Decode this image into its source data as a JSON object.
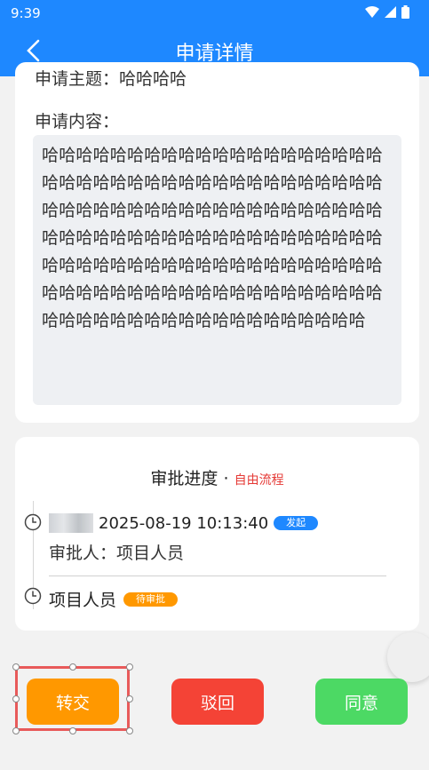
{
  "status_bar": {
    "time": "9:39",
    "icons": [
      "wifi-icon",
      "signal-icon",
      "battery-icon"
    ]
  },
  "app_bar": {
    "title": "申请详情",
    "back_icon": "chevron-left-icon"
  },
  "application": {
    "subject_text": "申请主题：哈哈哈哈",
    "content_label": "申请内容：",
    "content_text": "哈哈哈哈哈哈哈哈哈哈哈哈哈哈哈哈哈哈哈哈哈哈哈哈哈哈哈哈哈哈哈哈哈哈哈哈哈哈哈哈哈哈哈哈哈哈哈哈哈哈哈哈哈哈哈哈哈哈哈哈哈哈哈哈哈哈哈哈哈哈哈哈哈哈哈哈哈哈哈哈哈哈哈哈哈哈哈哈哈哈哈哈哈哈哈哈哈哈哈哈哈哈哈哈哈哈哈哈哈哈哈哈哈哈哈哈哈哈哈哈哈哈哈哈哈哈哈哈哈哈哈哈哈哈哈哈哈哈哈"
  },
  "progress": {
    "title": "审批进度",
    "separator": "·",
    "mode": "自由流程",
    "node1": {
      "datetime": "2025-08-19 10:13:40",
      "badge": "发起",
      "approver": "审批人：项目人员"
    },
    "node2": {
      "name": "项目人员",
      "badge": "待审批"
    }
  },
  "actions": {
    "transfer": "转交",
    "reject": "驳回",
    "agree": "同意"
  },
  "colors": {
    "primary": "#1e88ff",
    "transfer": "#ff9800",
    "reject": "#f44336",
    "agree": "#4cd964",
    "mode_text": "#e53935"
  }
}
